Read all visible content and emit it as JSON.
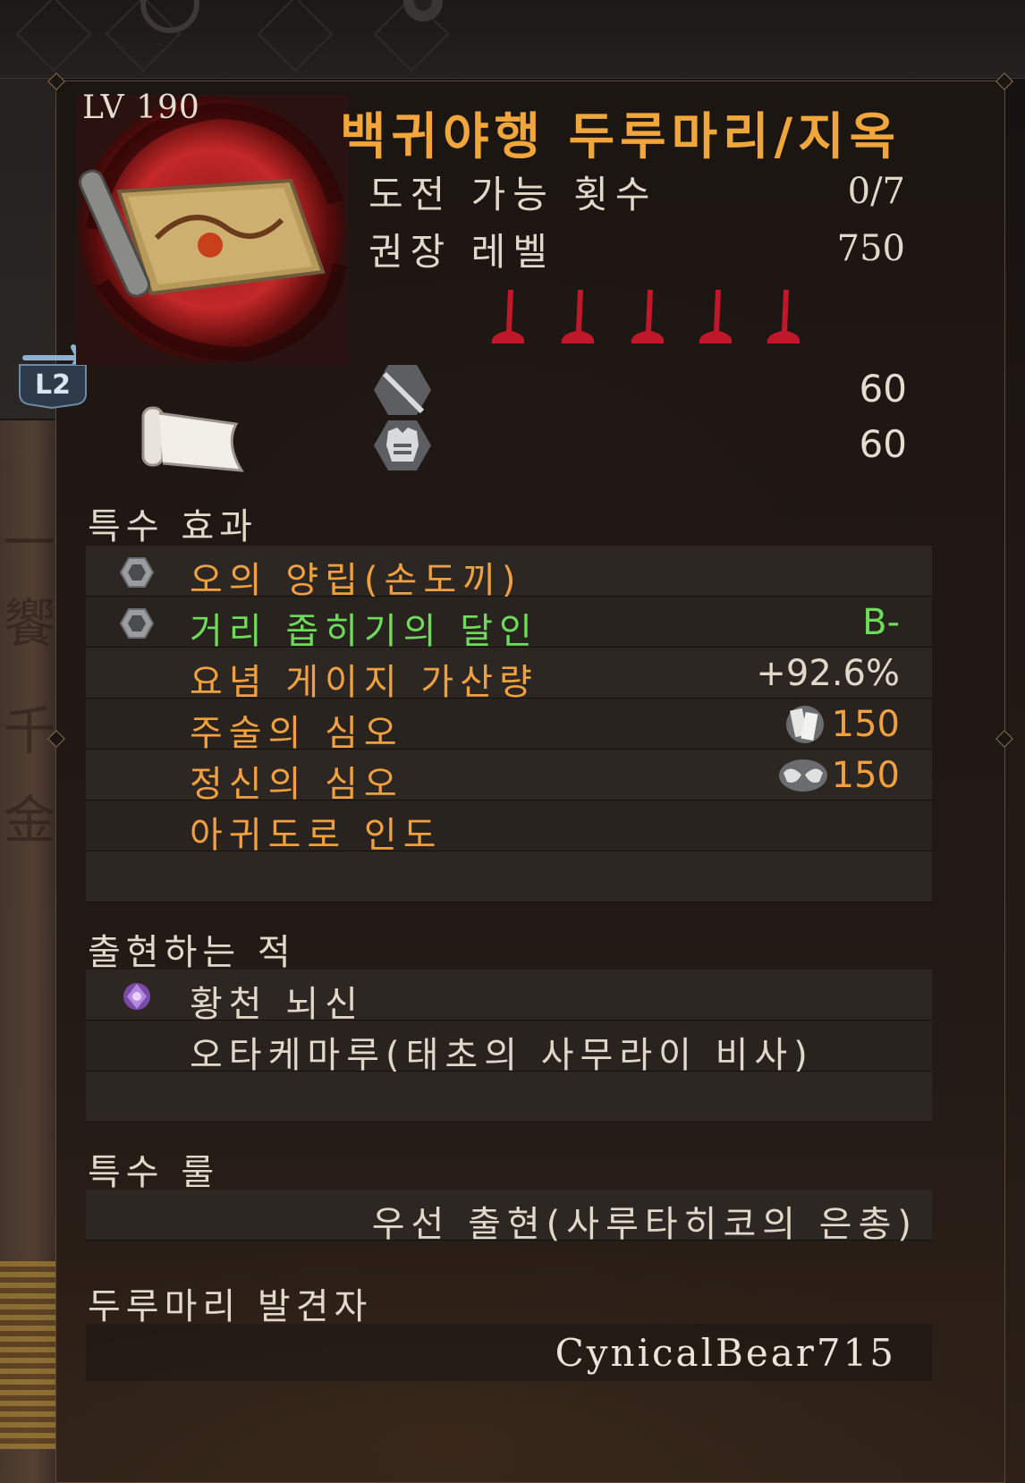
{
  "item": {
    "level": "LV 190",
    "title": "백귀야행 두루마리/지옥",
    "stats": [
      {
        "label": "도전 가능 횟수",
        "value": "0/7"
      },
      {
        "label": "권장 레벨",
        "value": "750"
      }
    ],
    "rank_pins": 5,
    "weapon_value": "60",
    "armor_value": "60"
  },
  "controls": {
    "switch_button": "L2"
  },
  "special_effects": {
    "title": "특수 효과",
    "rows": [
      {
        "text": "오의 양립(손도끼)",
        "value": "",
        "icon": "hex-gem-icon",
        "color": "orange"
      },
      {
        "text": "거리 좁히기의 달인",
        "value": "B-",
        "icon": "hex-gem-icon",
        "color": "green"
      },
      {
        "text": "요념 게이지 가산량",
        "value": "+92.6%",
        "icon": "",
        "color": "orange"
      },
      {
        "text": "주술의 심오",
        "value": "150",
        "icon": "talisman-icon",
        "color": "orange"
      },
      {
        "text": "정신의 심오",
        "value": "150",
        "icon": "hands-icon",
        "color": "orange"
      },
      {
        "text": "아귀도로 인도",
        "value": "",
        "icon": "",
        "color": "orange"
      }
    ]
  },
  "enemies": {
    "title": "출현하는 적",
    "rows": [
      {
        "text": "황천 뇌신",
        "icon": "purple-spirit-icon"
      },
      {
        "text": "오타케마루(태초의 사무라이 비사)",
        "icon": ""
      }
    ]
  },
  "special_rule": {
    "title": "특수 룰",
    "text": "우선 출현(사루타히코의 은총)"
  },
  "discoverer": {
    "title": "두루마리 발견자",
    "name": "CynicalBear715"
  },
  "colors": {
    "title_orange": "#f0a63a",
    "effect_orange": "#f0a040",
    "effect_green": "#6cdc5a",
    "rank_red": "#c0182a"
  }
}
